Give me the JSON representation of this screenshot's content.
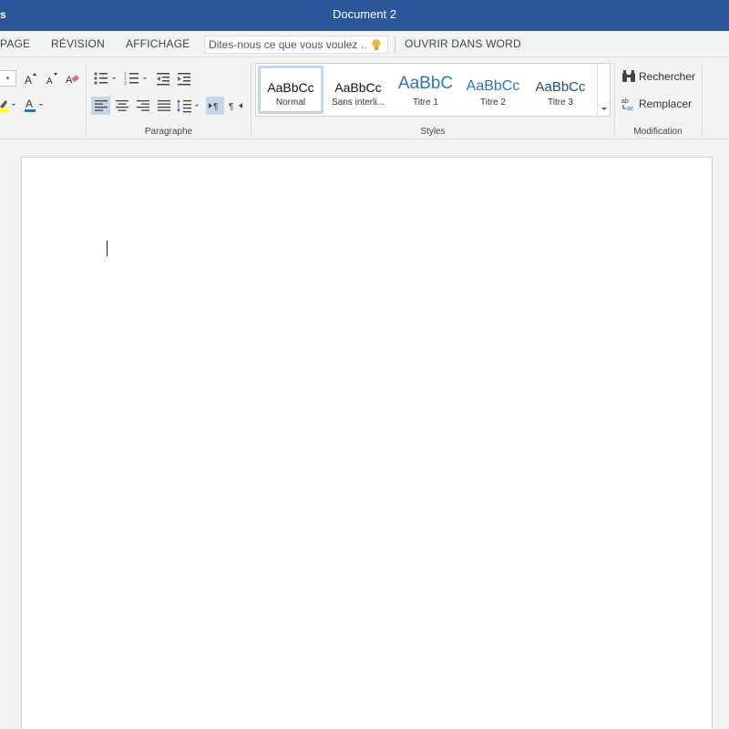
{
  "titlebar": {
    "left_fragment": "s",
    "document_title": "Document 2",
    "color": "#2b579a"
  },
  "tabs": {
    "items": [
      "PAGE",
      "RÉVISION",
      "AFFICHAGE"
    ],
    "tell_me_placeholder": "Dites-nous ce que vous voulez ...",
    "open_in_word": "OUVRIR DANS WORD"
  },
  "ribbon": {
    "groups": {
      "paragraph": "Paragraphe",
      "styles": "Styles",
      "editing": "Modification"
    },
    "styles": [
      {
        "sample": "AaBbCc",
        "name": "Normal"
      },
      {
        "sample": "AaBbCc",
        "name": "Sans interli..."
      },
      {
        "sample": "AaBbC",
        "name": "Titre 1"
      },
      {
        "sample": "AaBbCc",
        "name": "Titre 2"
      },
      {
        "sample": "AaBbCc",
        "name": "Titre 3"
      }
    ],
    "editing": {
      "find": "Rechercher",
      "replace": "Remplacer"
    },
    "icons": [
      "grow-font-icon",
      "shrink-font-icon",
      "clear-formatting-icon",
      "highlight-icon",
      "font-color-icon",
      "bullets-icon",
      "numbering-icon",
      "decrease-indent-icon",
      "increase-indent-icon",
      "align-left-icon",
      "align-center-icon",
      "align-right-icon",
      "justify-icon",
      "line-spacing-icon",
      "ltr-icon",
      "rtl-icon",
      "binoculars-icon",
      "replace-icon",
      "lightbulb-icon"
    ]
  },
  "colors": {
    "accent": "#2b579a",
    "heading_blue": "#2e74b5",
    "highlight_yellow": "#ffff00",
    "font_color_red": "#c00000"
  }
}
